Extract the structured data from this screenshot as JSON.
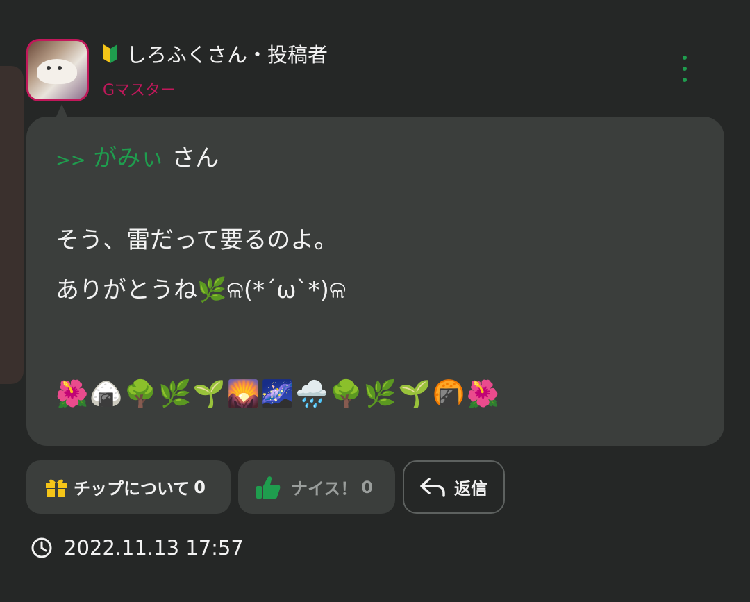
{
  "post": {
    "author_name": "しろふくさん・投稿者",
    "author_rank": "Gマスター",
    "reply_prefix": ">>",
    "reply_target": "がみぃ",
    "reply_honorific": "さん",
    "message_line1": "そう、雷だって要るのよ。",
    "message_line2": "ありがとうね🌿ଳ(*´ω`*)ଳ",
    "emoji_line": "🌺🍙🌳🌿🌱🌄🌌🌧️🌳🌿🌱🍘🌺",
    "timestamp": "2022.11.13 17:57"
  },
  "actions": {
    "tip_label": "チップについて",
    "tip_count": "0",
    "nice_label": "ナイス！",
    "nice_count": "0",
    "reply_label": "返信"
  },
  "icons": {
    "beginner": "beginner-mark-icon",
    "menu": "more-vertical-icon",
    "tip": "gift-icon",
    "nice": "thumbs-up-icon",
    "reply": "reply-arrow-icon",
    "time": "clock-icon"
  },
  "colors": {
    "background": "#252726",
    "bubble": "#3b3e3c",
    "accent_green": "#1f9d4e",
    "rank_pink": "#c2185b",
    "gift_yellow": "#f5c518"
  }
}
